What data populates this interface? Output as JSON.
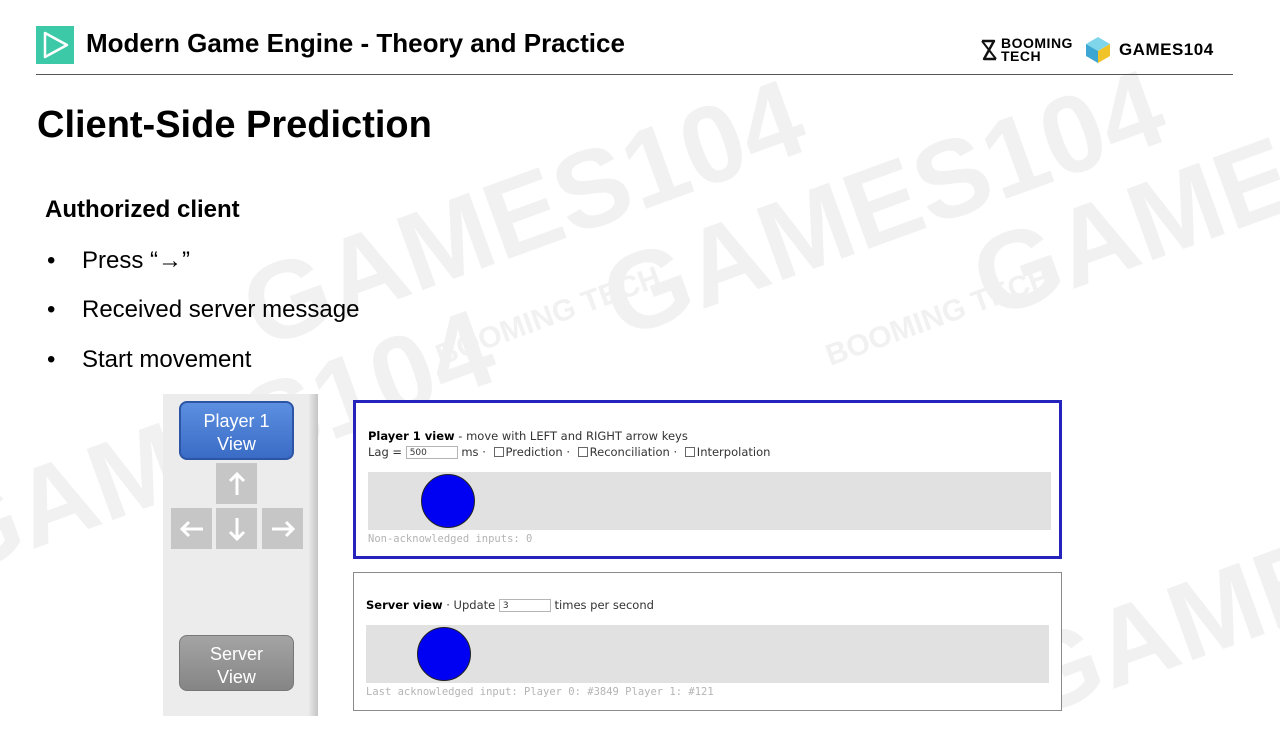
{
  "header": {
    "title": "Modern Game Engine - Theory and Practice",
    "brand_left_top": "BOOMING",
    "brand_left_bottom": "TECH",
    "brand_right": "GAMES104"
  },
  "watermark": {
    "text": "GAMES104",
    "small_text": "BOOMING TECH"
  },
  "slide": {
    "title": "Client-Side Prediction",
    "subtitle": "Authorized client",
    "bullets": [
      "Press “→”",
      "Received server message",
      "Start movement"
    ]
  },
  "panel": {
    "player1_button": [
      "Player 1",
      "View"
    ],
    "server_button": [
      "Server",
      "View"
    ],
    "keys": [
      "up-arrow",
      "left-arrow",
      "down-arrow",
      "right-arrow"
    ]
  },
  "player_view": {
    "heading": "Player 1 view",
    "heading_rest": " - move with LEFT and RIGHT arrow keys",
    "lag_label": "Lag = ",
    "lag_value": "500",
    "lag_unit": "ms · ",
    "prediction": "Prediction · ",
    "reconciliation": "Reconciliation · ",
    "interpolation": "Interpolation",
    "status": "Non-acknowledged inputs: 0",
    "ball_color": "#0000f2"
  },
  "server_view": {
    "heading": "Server view",
    "update_label": " · Update ",
    "update_value": "3",
    "update_unit": "times per second",
    "status": "Last acknowledged input: Player 0: #3849 Player 1: #121",
    "ball_color": "#0000f2"
  }
}
